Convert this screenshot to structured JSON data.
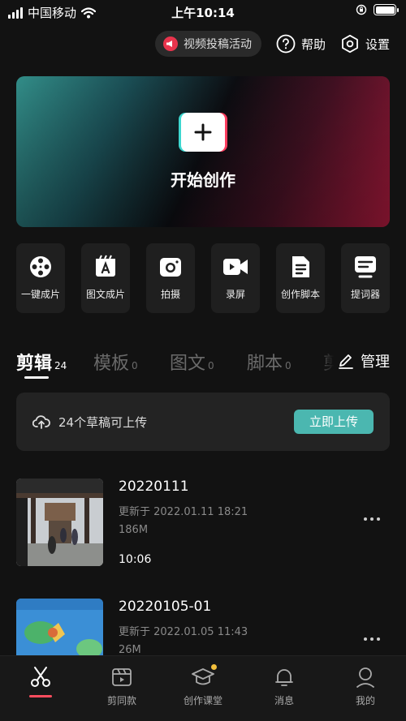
{
  "status_bar": {
    "carrier": "中国移动",
    "time": "上午10:14"
  },
  "topbar": {
    "promo_label": "视频投稿活动",
    "help_label": "帮助",
    "settings_label": "设置"
  },
  "hero": {
    "title": "开始创作"
  },
  "tools": [
    {
      "label": "一键成片",
      "icon": "film-reel-icon"
    },
    {
      "label": "图文成片",
      "icon": "text-image-icon"
    },
    {
      "label": "拍摄",
      "icon": "camera-icon"
    },
    {
      "label": "录屏",
      "icon": "screen-record-icon"
    },
    {
      "label": "创作脚本",
      "icon": "script-icon"
    },
    {
      "label": "提词器",
      "icon": "teleprompter-icon"
    }
  ],
  "tabs": [
    {
      "label": "剪辑",
      "count": "24"
    },
    {
      "label": "模板",
      "count": "0"
    },
    {
      "label": "图文",
      "count": "0"
    },
    {
      "label": "脚本",
      "count": "0"
    },
    {
      "label": "剪"
    }
  ],
  "manage_label": "管理",
  "upload": {
    "text": "24个草稿可上传",
    "button": "立即上传"
  },
  "drafts": [
    {
      "name": "20220111",
      "updated": "更新于 2022.01.11 18:21",
      "size": "186M",
      "duration": "10:06"
    },
    {
      "name": "20220105-01",
      "updated": "更新于 2022.01.05 11:43",
      "size": "26M",
      "duration": ""
    }
  ],
  "nav": [
    {
      "label": "",
      "icon": "scissors-icon"
    },
    {
      "label": "剪同款",
      "icon": "clapperboard-icon"
    },
    {
      "label": "创作课堂",
      "icon": "graduation-cap-icon"
    },
    {
      "label": "消息",
      "icon": "bell-icon"
    },
    {
      "label": "我的",
      "icon": "user-icon"
    }
  ],
  "colors": {
    "accent": "#4bb7b0",
    "active_tab_indicator": "#ff4d5e",
    "promo_red": "#e8344d"
  }
}
